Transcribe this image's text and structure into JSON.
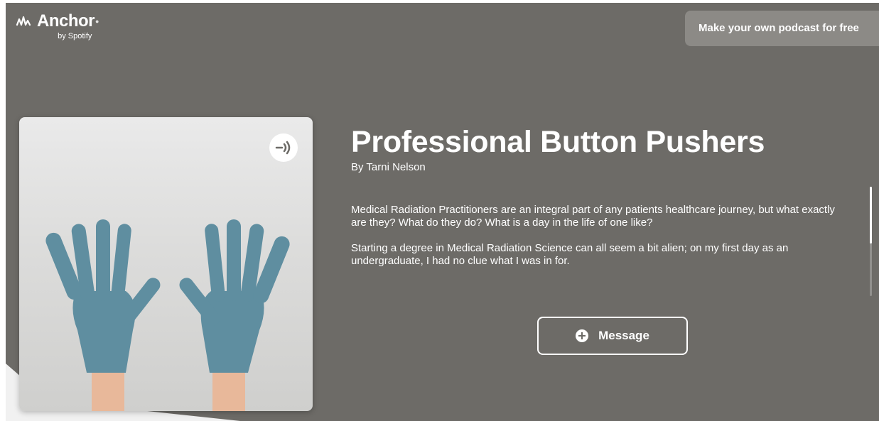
{
  "brand": {
    "name": "Anchor",
    "sub": "by Spotify"
  },
  "header": {
    "cta_label": "Make your own podcast for free"
  },
  "podcast": {
    "title": "Professional Button Pushers",
    "author": "By Tarni Nelson",
    "description": [
      "Medical Radiation Practitioners are an integral part of any patients healthcare journey, but what exactly are they? What do they do? What is a day in the life of one like?",
      "Starting a degree in Medical Radiation Science can all seem a bit alien; on my first day as an undergraduate, I had no clue what I was in for."
    ],
    "cover_badge_icon": "podcast-icon"
  },
  "actions": {
    "message_label": "Message",
    "message_icon": "plus-circle-icon"
  },
  "colors": {
    "background": "#6d6b67",
    "cta_background": "#8c8a86",
    "glove": "#5f8ea0",
    "text": "#ffffff"
  }
}
